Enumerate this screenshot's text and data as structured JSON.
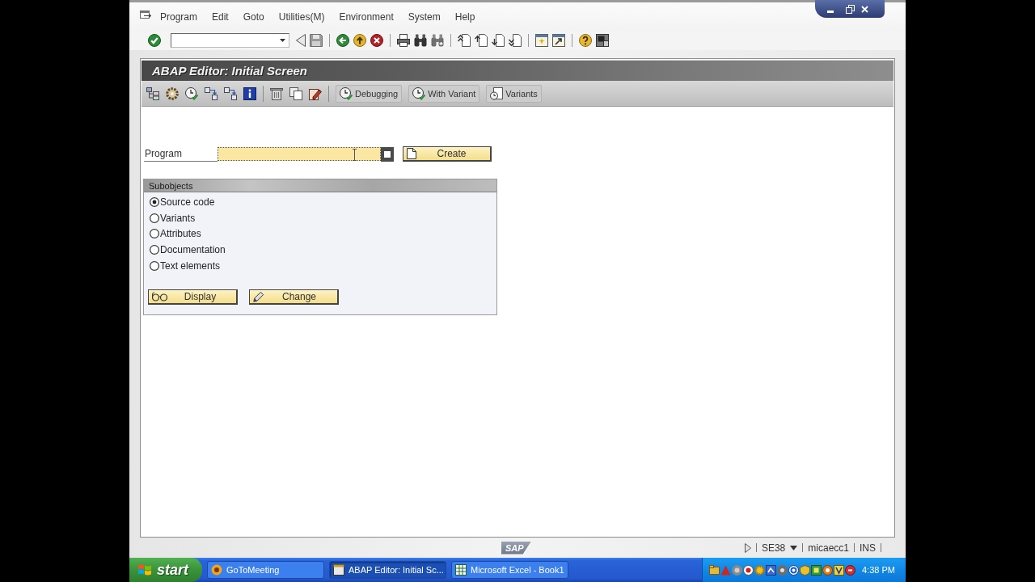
{
  "menu_bar": {
    "items": [
      "Program",
      "Edit",
      "Goto",
      "Utilities(M)",
      "Environment",
      "System",
      "Help"
    ]
  },
  "title": "ABAP Editor: Initial Screen",
  "application_toolbar": {
    "buttons": [
      "Debugging",
      "With Variant",
      "Variants"
    ]
  },
  "program": {
    "label": "Program",
    "create_button": "Create"
  },
  "subobjects": {
    "title": "Subobjects",
    "options": [
      {
        "label": "Source code",
        "selected": true
      },
      {
        "label": "Variants",
        "selected": false
      },
      {
        "label": "Attributes",
        "selected": false
      },
      {
        "label": "Documentation",
        "selected": false
      },
      {
        "label": "Text elements",
        "selected": false
      }
    ],
    "buttons": [
      "Display",
      "Change"
    ]
  },
  "status_bar": {
    "logo": "SAP",
    "fields": [
      "SE38",
      "micaecc1",
      "INS"
    ]
  },
  "taskbar": {
    "start": "start",
    "tasks": [
      {
        "label": "GoToMeeting",
        "selected": false
      },
      {
        "label": "ABAP Editor: Initial Sc...",
        "selected": true
      },
      {
        "label": "Microsoft Excel - Book1",
        "selected": false
      }
    ],
    "clock": "4:38 PM"
  }
}
